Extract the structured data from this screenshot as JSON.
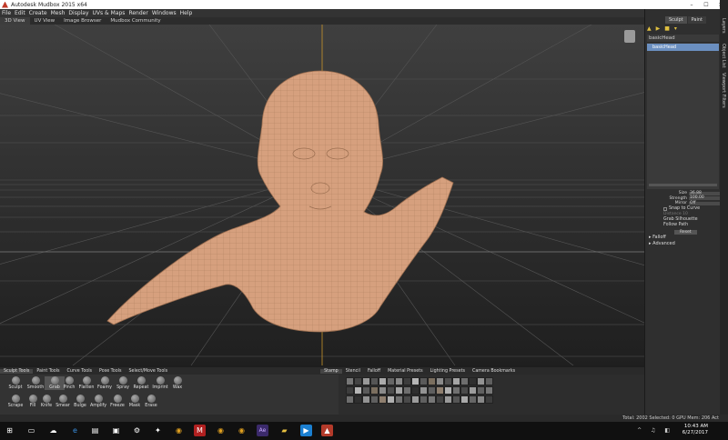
{
  "window": {
    "title": "Autodesk Mudbox 2015 x64",
    "controls": [
      "–",
      "☐",
      "✕"
    ]
  },
  "menu": [
    "File",
    "Edit",
    "Create",
    "Mesh",
    "Display",
    "UVs & Maps",
    "Render",
    "Windows",
    "Help"
  ],
  "view_tabs": [
    "3D View",
    "UV View",
    "Image Browser",
    "Mudbox Community"
  ],
  "right_panel": {
    "tabs": [
      "Sculpt",
      "Paint"
    ],
    "side_tabs": [
      "Layers",
      "Object List",
      "Viewport Filters"
    ],
    "layer_header": "basicHead",
    "layer_item": "basicHead",
    "props": {
      "size_label": "Size",
      "size_value": "36.88",
      "strength_label": "Strength",
      "strength_value": "100.00",
      "mirror_label": "Mirror",
      "mirror_value": "Off",
      "snap_label": "Snap to Curve",
      "distance_label": "Distance",
      "distance_value": "10",
      "grab_label": "Grab Silhouette",
      "follow_label": "Follow Path",
      "reset_label": "Reset",
      "falloff_label": "Falloff",
      "advanced_label": "Advanced"
    }
  },
  "bottom_tabs_left": [
    "Sculpt Tools",
    "Paint Tools",
    "Curve Tools",
    "Pose Tools",
    "Select/Move Tools"
  ],
  "bottom_tabs_right": [
    "Stamp",
    "Stencil",
    "Falloff",
    "Material Presets",
    "Lighting Presets",
    "Camera Bookmarks"
  ],
  "tools_row1": [
    "Sculpt",
    "Smooth",
    "Grab",
    "Pinch",
    "Flatten",
    "Foamy",
    "Spray",
    "Repeat",
    "Imprint",
    "Wax"
  ],
  "tools_row2": [
    "Scrape",
    "Fill",
    "Knife",
    "Smear",
    "Bulge",
    "Amplify",
    "Freeze",
    "Mask",
    "Erase"
  ],
  "status": "Total: 2002  Selected: 0  GPU Mem: 206  Act",
  "clock": {
    "time": "10:43 AM",
    "date": "6/27/2017"
  },
  "colors": {
    "skin": "#d6a07e",
    "wire": "#b0805f",
    "selection": "#6b8fc0"
  }
}
